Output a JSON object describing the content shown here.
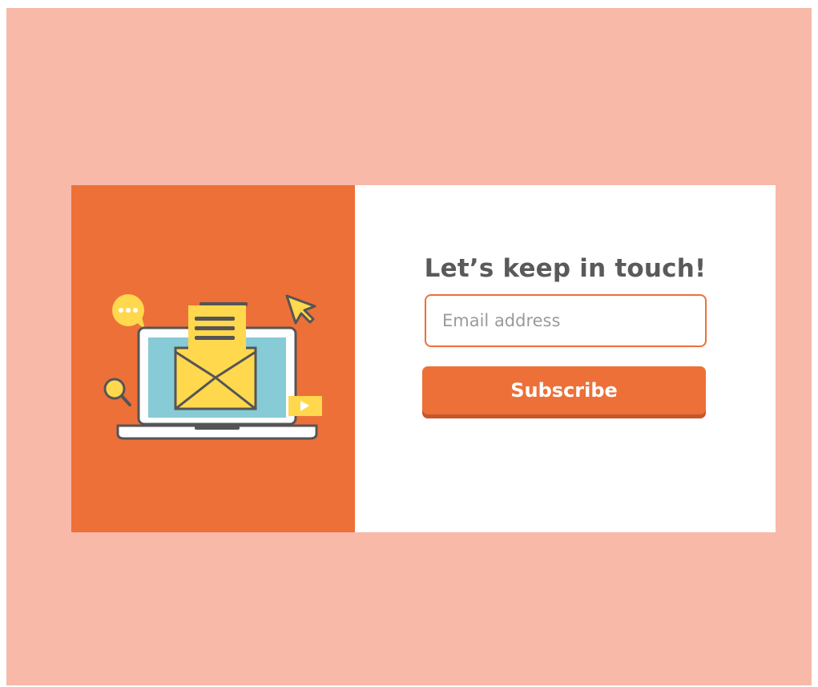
{
  "signup": {
    "heading": "Let’s keep in touch!",
    "email_placeholder": "Email address",
    "email_value": "",
    "subscribe_label": "Subscribe"
  },
  "colors": {
    "page_background": "#f8b9a8",
    "accent": "#ed7039",
    "illustration_yellow": "#ffd84d",
    "screen_blue": "#86cbd5",
    "outline_gray": "#555555"
  },
  "illustration_icons": [
    "chat-bubble-icon",
    "cursor-arrow-icon",
    "laptop-icon",
    "envelope-icon",
    "document-icon",
    "magnifier-icon",
    "play-video-icon"
  ]
}
